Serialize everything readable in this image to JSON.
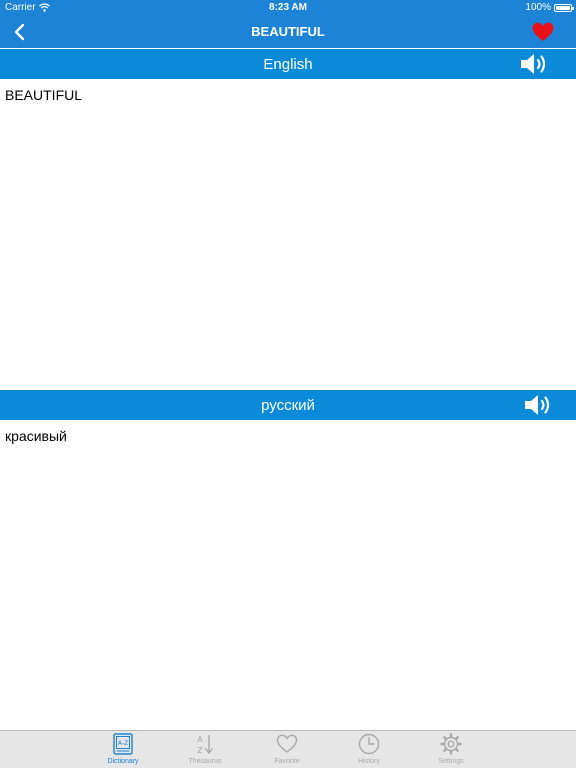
{
  "status_bar": {
    "carrier": "Carrier",
    "time": "8:23 AM",
    "battery": "100%",
    "battery_level": 1.0
  },
  "nav": {
    "title": "BEAUTIFUL",
    "back_icon": "chevron-left-icon",
    "favorite_icon": "heart-icon"
  },
  "source": {
    "language": "English",
    "text": "BEAUTIFUL",
    "speaker_icon": "speaker-icon"
  },
  "target": {
    "language": "русский",
    "text": "красивый",
    "speaker_icon": "speaker-icon"
  },
  "tabs": [
    {
      "label": "Dictionary",
      "icon": "dictionary-icon",
      "active": true
    },
    {
      "label": "Thesaurus",
      "icon": "az-sort-icon",
      "active": false
    },
    {
      "label": "Favorite",
      "icon": "heart-outline-icon",
      "active": false
    },
    {
      "label": "History",
      "icon": "clock-icon",
      "active": false
    },
    {
      "label": "Settings",
      "icon": "gear-icon",
      "active": false
    }
  ],
  "colors": {
    "nav_blue": "#1c83d6",
    "section_blue": "#0a8ad8",
    "heart_red": "#e8111a",
    "tab_active": "#1c83d6",
    "tab_inactive": "#a9a9a9"
  }
}
